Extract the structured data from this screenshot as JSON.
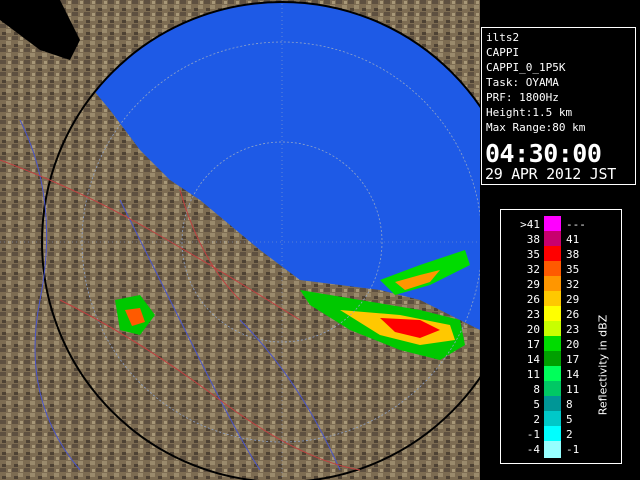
{
  "info_panel": {
    "lines": [
      "ilts2",
      "CAPPI",
      "CAPPI_0_1P5K",
      "Task: OYAMA",
      "PRF: 1800Hz",
      "Height:1.5 km",
      "Max Range:80 km"
    ],
    "time": "04:30:00",
    "date": "29 APR 2012 JST"
  },
  "legend": {
    "unit_label": "Reflectivity in dBZ",
    "rows": [
      {
        "left": ">41",
        "right": "---",
        "color": "#ff00ff"
      },
      {
        "left": "38",
        "right": "41",
        "color": "#c8006e"
      },
      {
        "left": "35",
        "right": "38",
        "color": "#ff0000"
      },
      {
        "left": "32",
        "right": "35",
        "color": "#ff5a00"
      },
      {
        "left": "29",
        "right": "32",
        "color": "#ff9600"
      },
      {
        "left": "26",
        "right": "29",
        "color": "#ffc800"
      },
      {
        "left": "23",
        "right": "26",
        "color": "#ffff00"
      },
      {
        "left": "20",
        "right": "23",
        "color": "#c8ff00"
      },
      {
        "left": "17",
        "right": "20",
        "color": "#00dc00"
      },
      {
        "left": "14",
        "right": "17",
        "color": "#00a000"
      },
      {
        "left": "11",
        "right": "14",
        "color": "#00ff5a"
      },
      {
        "left": "8",
        "right": "11",
        "color": "#00c864"
      },
      {
        "left": "5",
        "right": "8",
        "color": "#009696"
      },
      {
        "left": "2",
        "right": "5",
        "color": "#00c8c8"
      },
      {
        "left": "-1",
        "right": "2",
        "color": "#00ffff"
      },
      {
        "left": "-4",
        "right": "-1",
        "color": "#96ffff"
      }
    ]
  },
  "colors": {
    "sea_echo": "#1e5ae6",
    "background": "#000000",
    "terrain": "#7a6a50",
    "rivers": "#4a55c8",
    "boundaries": "#c04040"
  }
}
